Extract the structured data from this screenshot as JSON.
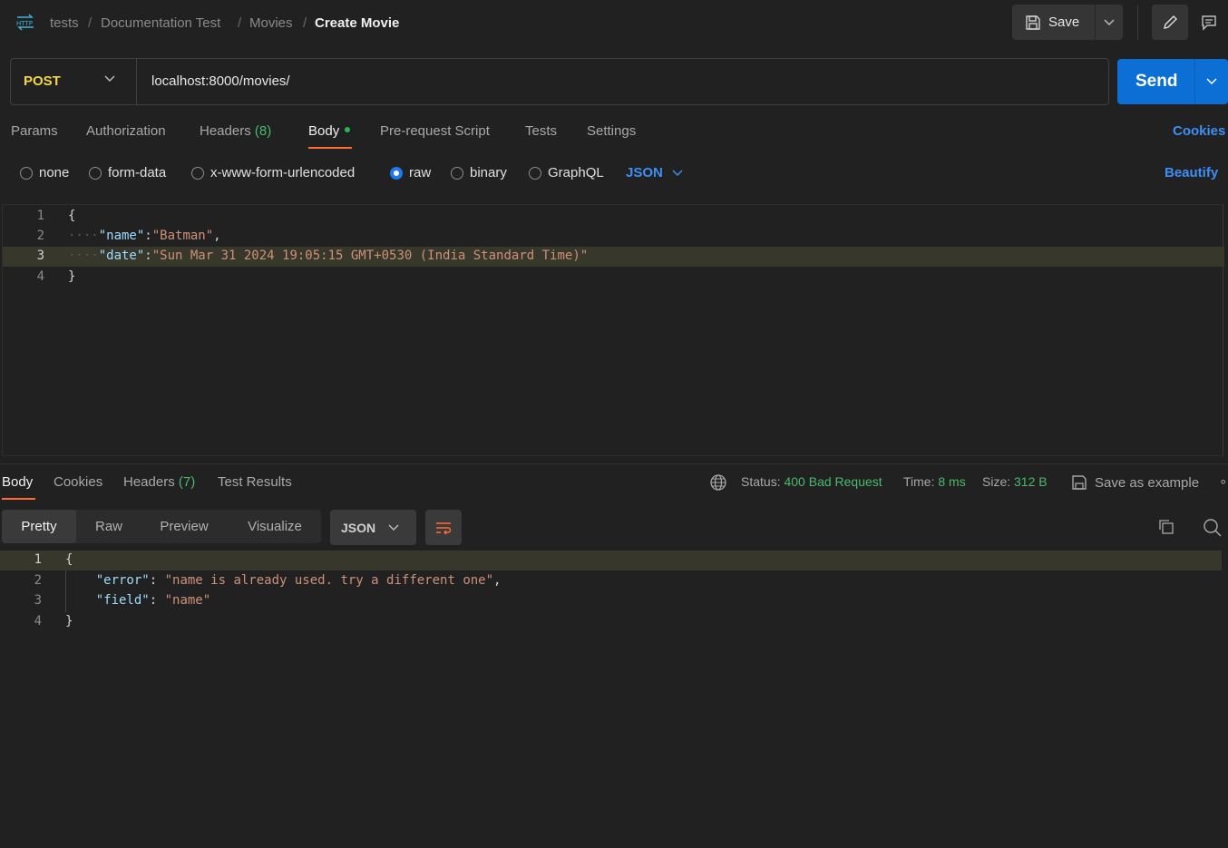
{
  "breadcrumb": {
    "items": [
      "tests",
      "Documentation Test",
      "Movies"
    ],
    "separator": "/",
    "current": "Create Movie"
  },
  "toolbar": {
    "save_label": "Save"
  },
  "request": {
    "method": "POST",
    "url": "localhost:8000/movies/",
    "send_label": "Send"
  },
  "request_tabs": {
    "params": "Params",
    "authorization": "Authorization",
    "headers": "Headers",
    "headers_count": "(8)",
    "body": "Body",
    "prerequest": "Pre-request Script",
    "tests": "Tests",
    "settings": "Settings",
    "cookies": "Cookies"
  },
  "body_types": {
    "none": "none",
    "form_data": "form-data",
    "urlencoded": "x-www-form-urlencoded",
    "raw": "raw",
    "binary": "binary",
    "graphql": "GraphQL",
    "selected": "raw",
    "language": "JSON",
    "beautify": "Beautify"
  },
  "request_body": {
    "line_numbers": [
      "1",
      "2",
      "3",
      "4"
    ],
    "open": "{",
    "close": "}",
    "name_key": "\"name\"",
    "name_value": "\"Batman\"",
    "date_key": "\"date\"",
    "date_value": "\"Sun Mar 31 2024 19:05:15 GMT+0530 (India Standard Time)\""
  },
  "response_tabs": {
    "body": "Body",
    "cookies": "Cookies",
    "headers": "Headers",
    "headers_count": "(7)",
    "test_results": "Test Results"
  },
  "response_status": {
    "status_label": "Status:",
    "status_value": "400 Bad Request",
    "time_label": "Time:",
    "time_value": "8 ms",
    "size_label": "Size:",
    "size_value": "312 B",
    "save_example": "Save as example"
  },
  "response_view": {
    "pretty": "Pretty",
    "raw": "Raw",
    "preview": "Preview",
    "visualize": "Visualize",
    "format": "JSON"
  },
  "response_body": {
    "line_numbers": [
      "1",
      "2",
      "3",
      "4"
    ],
    "open": "{",
    "close": "}",
    "error_key": "\"error\"",
    "error_value": "\"name is already used. try a different one\"",
    "field_key": "\"field\"",
    "field_value": "\"name\""
  },
  "colors": {
    "accent_orange": "#ff6c37",
    "send_blue": "#0b6fd6",
    "link_blue": "#3d8ff7",
    "method_yellow": "#f5d54a",
    "status_green": "#49b96c"
  }
}
